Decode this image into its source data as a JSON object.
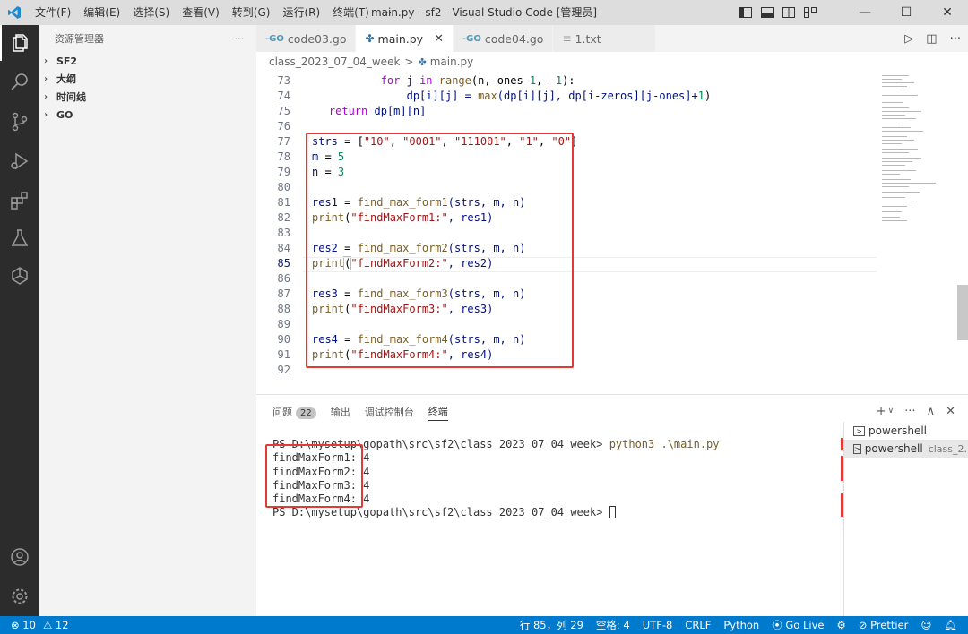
{
  "titlebar": {
    "menus": [
      "文件(F)",
      "编辑(E)",
      "选择(S)",
      "查看(V)",
      "转到(G)",
      "运行(R)",
      "终端(T)",
      "···"
    ],
    "title": "main.py - sf2 - Visual Studio Code [管理员]",
    "controls": {
      "minimize": "—",
      "maximize": "☐",
      "close": "✕"
    }
  },
  "sidebar": {
    "title": "资源管理器",
    "more": "···",
    "sections": [
      "SF2",
      "大纲",
      "时间线",
      "GO"
    ]
  },
  "tabs": [
    {
      "label": "code03.go",
      "icon": "-GO"
    },
    {
      "label": "main.py",
      "icon": "✤",
      "close": "✕"
    },
    {
      "label": "code04.go",
      "icon": "-GO"
    },
    {
      "label": "1.txt",
      "icon": "≡"
    }
  ],
  "editor_actions": {
    "run": "▷",
    "split": "◫",
    "more": "···"
  },
  "breadcrumb": {
    "folder": "class_2023_07_04_week",
    "sep": ">",
    "file": "main.py"
  },
  "code": {
    "line_numbers": [
      "73",
      "74",
      "75",
      "76",
      "77",
      "78",
      "79",
      "80",
      "81",
      "82",
      "83",
      "84",
      "85",
      "86",
      "87",
      "88",
      "89",
      "90",
      "91",
      "92"
    ],
    "lines": {
      "l73": {
        "indent": "            ",
        "kw": "for",
        "a": " j ",
        "kw2": "in",
        "fn": " range",
        "rest": "(n, ones-",
        "n1": "1",
        "c": ", -",
        "n2": "1",
        "end": "):"
      },
      "l74": {
        "text": "                dp[i][j] = max(dp[i][j], dp[i-zeros][j-ones]+1)",
        "indent": "                ",
        "p1": "dp[i][j] = ",
        "fn": "max",
        "p2": "(dp[i][j], dp[i-zeros][j-ones]+",
        "n": "1",
        "p3": ")"
      },
      "l75": {
        "indent": "    ",
        "kw": "return",
        "rest": " dp[m][n]"
      },
      "l77": {
        "var": "strs",
        "eq": " = [",
        "s1": "\"10\"",
        "c1": ", ",
        "s2": "\"0001\"",
        "c2": ", ",
        "s3": "\"111001\"",
        "c3": ", ",
        "s4": "\"1\"",
        "c4": ", ",
        "s5": "\"0\"",
        "end": "]"
      },
      "l78": {
        "var": "m",
        "eq": " = ",
        "num": "5"
      },
      "l79": {
        "var": "n",
        "eq": " = ",
        "num": "3"
      },
      "l81": {
        "var": "res1",
        "eq": " = ",
        "fn": "find_max_form1",
        "args": "(strs, m, n)"
      },
      "l82": {
        "fn": "print",
        "open": "(",
        "str": "\"findMaxForm1:\"",
        "rest": ", res1)"
      },
      "l84": {
        "var": "res2",
        "eq": " = ",
        "fn": "find_max_form2",
        "args": "(strs, m, n)"
      },
      "l85": {
        "fn": "print",
        "open": "(",
        "str": "\"findMaxForm2:\"",
        "rest": ", res2)"
      },
      "l87": {
        "var": "res3",
        "eq": " = ",
        "fn": "find_max_form3",
        "args": "(strs, m, n)"
      },
      "l88": {
        "fn": "print",
        "open": "(",
        "str": "\"findMaxForm3:\"",
        "rest": ", res3)"
      },
      "l90": {
        "var": "res4",
        "eq": " = ",
        "fn": "find_max_form4",
        "args": "(strs, m, n)"
      },
      "l91": {
        "fn": "print",
        "open": "(",
        "str": "\"findMaxForm4:\"",
        "rest": ", res4)"
      }
    }
  },
  "panel": {
    "tabs": [
      "问题",
      "输出",
      "调试控制台",
      "终端"
    ],
    "problems_count": "22",
    "actions": {
      "add": "+",
      "dropdown": "∨",
      "more": "···",
      "maximize": "∧",
      "close": "✕"
    },
    "terminal": {
      "prompt": "PS D:\\mysetup\\gopath\\src\\sf2\\class_2023_07_04_week> ",
      "command": "python3 .\\main.py",
      "output": [
        "findMaxForm1: 4",
        "findMaxForm2: 4",
        "findMaxForm3: 4",
        "findMaxForm4: 4"
      ],
      "prompt2": "PS D:\\mysetup\\gopath\\src\\sf2\\class_2023_07_04_week> "
    },
    "terminal_list": [
      {
        "label": "powershell",
        "sub": ""
      },
      {
        "label": "powershell",
        "sub": "class_2..."
      }
    ]
  },
  "statusbar": {
    "errors": "⊗ 10",
    "warnings": "⚠ 12",
    "position": "行 85，列 29",
    "spaces": "空格: 4",
    "encoding": "UTF-8",
    "eol": "CRLF",
    "language": "Python",
    "golive": "Go Live",
    "prettier": "Prettier"
  }
}
